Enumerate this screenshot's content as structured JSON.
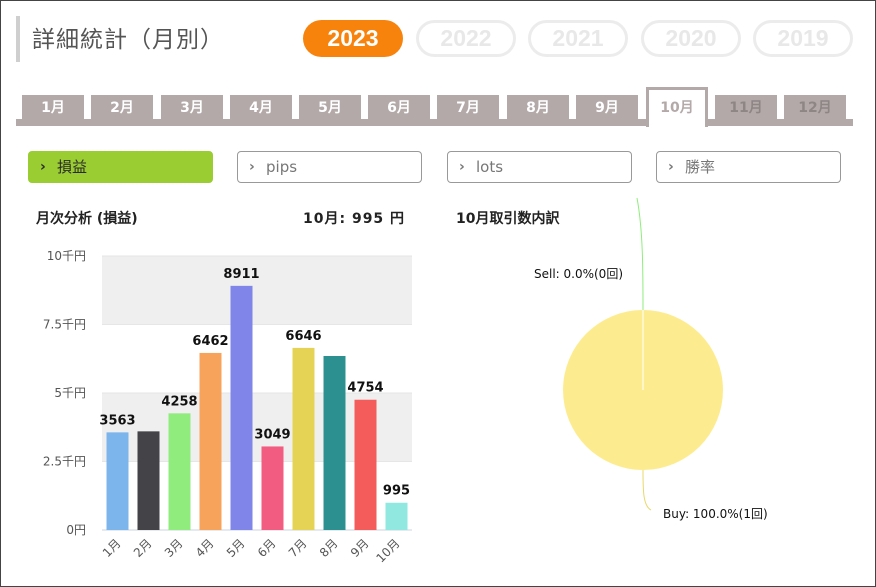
{
  "header": {
    "title": "詳細統計（月別）"
  },
  "years": [
    {
      "label": "2023",
      "active": true
    },
    {
      "label": "2022",
      "active": false
    },
    {
      "label": "2021",
      "active": false
    },
    {
      "label": "2020",
      "active": false
    },
    {
      "label": "2019",
      "active": false
    }
  ],
  "months": [
    {
      "label": "1月",
      "state": "past"
    },
    {
      "label": "2月",
      "state": "past"
    },
    {
      "label": "3月",
      "state": "past"
    },
    {
      "label": "4月",
      "state": "past"
    },
    {
      "label": "5月",
      "state": "past"
    },
    {
      "label": "6月",
      "state": "past"
    },
    {
      "label": "7月",
      "state": "past"
    },
    {
      "label": "8月",
      "state": "past"
    },
    {
      "label": "9月",
      "state": "past"
    },
    {
      "label": "10月",
      "state": "active"
    },
    {
      "label": "11月",
      "state": "future"
    },
    {
      "label": "12月",
      "state": "future"
    }
  ],
  "metrics": [
    {
      "label": "損益",
      "active": true
    },
    {
      "label": "pips",
      "active": false
    },
    {
      "label": "lots",
      "active": false
    },
    {
      "label": "勝率",
      "active": false
    }
  ],
  "bar_chart_heading": "月次分析 (損益)",
  "bar_chart_summary": "10月:  995 円",
  "pie_chart_heading": "10月取引数内訳",
  "colors": {
    "accent": "#f7830d",
    "metric_active": "#9acd32",
    "tab": "#b3a9a9"
  },
  "chart_data": [
    {
      "type": "bar",
      "categories": [
        "1月",
        "2月",
        "3月",
        "4月",
        "5月",
        "6月",
        "7月",
        "8月",
        "9月",
        "10月"
      ],
      "values": [
        3563,
        3600,
        4258,
        6462,
        8911,
        3049,
        6646,
        6350,
        4754,
        995
      ],
      "data_labels": [
        "3563",
        "",
        "4258",
        "6462",
        "8911",
        "3049",
        "6646",
        "",
        "4754",
        "995"
      ],
      "bar_colors": [
        "#7cb5ec",
        "#434348",
        "#90ed7d",
        "#f7a35c",
        "#8085e9",
        "#f15c80",
        "#e4d354",
        "#2b908f",
        "#f45b5b",
        "#91e8e1"
      ],
      "ylim": [
        0,
        10000
      ],
      "yticks": [
        0,
        2500,
        5000,
        7500,
        10000
      ],
      "ytick_labels": [
        "0円",
        "2.5千円",
        "5千円",
        "7.5千円",
        "10千円"
      ],
      "grid": "alternating bands"
    },
    {
      "type": "pie",
      "slices": [
        {
          "label": "Sell: 0.0%(0回)",
          "value": 0,
          "color": "#90ed7d"
        },
        {
          "label": "Buy: 100.0%(1回)",
          "value": 1,
          "color": "#fdec8f"
        }
      ]
    }
  ]
}
